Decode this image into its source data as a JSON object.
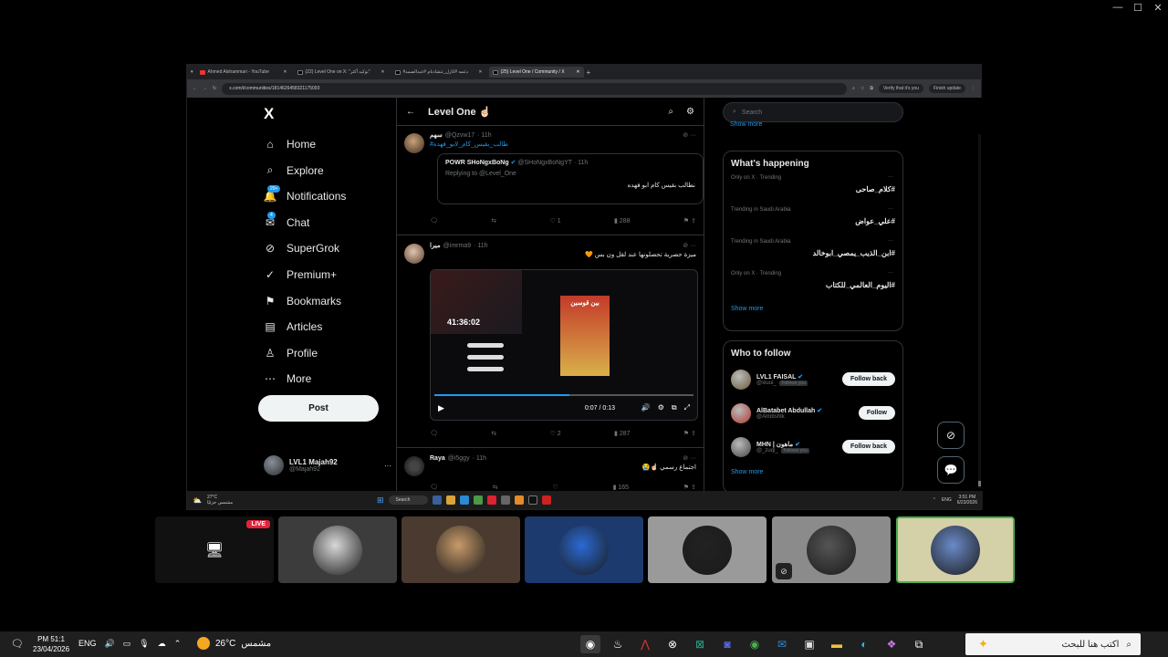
{
  "browser": {
    "tabs": [
      {
        "label": "Ahmed Alshammari - YouTube",
        "active": false
      },
      {
        "label": "(22) Level One on X: \"توكيد أكثر\"",
        "active": false
      },
      {
        "label": "#دعمه #کارل_تنشادنام #عبدالصمد",
        "active": false
      },
      {
        "label": "(25) Level One / Community / X",
        "active": true
      }
    ],
    "url": "x.com/i/communities/1814626458321175093",
    "verify_pill": "Verify that it's you",
    "finish_update": "Finish update"
  },
  "nav": {
    "logo": "X",
    "items": [
      {
        "label": "Home",
        "icon": "home-icon",
        "glyph": "⌂"
      },
      {
        "label": "Explore",
        "icon": "search-icon",
        "glyph": "⌕"
      },
      {
        "label": "Notifications",
        "icon": "bell-icon",
        "glyph": "🔔",
        "badge": "20+"
      },
      {
        "label": "Chat",
        "icon": "chat-icon",
        "glyph": "✉",
        "badge": "4"
      },
      {
        "label": "SuperGrok",
        "icon": "grok-icon",
        "glyph": "⊘"
      },
      {
        "label": "Premium+",
        "icon": "premium-icon",
        "glyph": "✓"
      },
      {
        "label": "Bookmarks",
        "icon": "bookmark-icon",
        "glyph": "⚑"
      },
      {
        "label": "Articles",
        "icon": "articles-icon",
        "glyph": "▤"
      },
      {
        "label": "Profile",
        "icon": "profile-icon",
        "glyph": "♙"
      },
      {
        "label": "More",
        "icon": "more-icon",
        "glyph": "⋯"
      }
    ],
    "post": "Post",
    "me": {
      "name": "LVL1 Majah92",
      "handle": "@Majah92"
    }
  },
  "feed": {
    "title": "Level One ☝🏻",
    "tweets": [
      {
        "name": "سهم",
        "handle": "@Qzvw17",
        "time": "· 11h",
        "text": "#طالب_بقيس_كام_لابو_فهده",
        "quote": {
          "name": "POWR SHoNgxBoNg",
          "handle": "@SHoNgxBoNgYT · 11h",
          "reply": "Replying to @Level_One",
          "text": "نطالب بقيس كام ابو فهده"
        },
        "stats": {
          "reply": "",
          "retweet": "",
          "like": "1",
          "views": "288"
        }
      },
      {
        "name": "ميرا",
        "handle": "@imrma9",
        "time": "· 11h",
        "text": "ميزة حصرية تحصلونها عند لقل ون بس 🧡",
        "video": {
          "counter": "41:36:02",
          "time": "0:07 / 0:13",
          "banner": "بين قوسين"
        },
        "stats": {
          "reply": "",
          "retweet": "",
          "like": "2",
          "views": "287"
        }
      },
      {
        "name": "Raya",
        "handle": "@i5ggy",
        "time": "· 11h",
        "text": "اجتماع رسمي ☝🏻😭",
        "stats": {
          "reply": "",
          "retweet": "",
          "like": "",
          "views": "165"
        }
      }
    ]
  },
  "right": {
    "search_placeholder": "Search",
    "show_more_top": "Show more",
    "happening_title": "What's happening",
    "trends": [
      {
        "context": "Only on X · Trending",
        "tag": "#كلام_صاحى"
      },
      {
        "context": "Trending in Saudi Arabia",
        "tag": "#علي_عواض"
      },
      {
        "context": "Trending in Saudi Arabia",
        "tag": "#ابن_الذيب_يمصي_ابوخالد"
      },
      {
        "context": "Only on X · Trending",
        "tag": "#اليوم_العالمي_للكتاب"
      }
    ],
    "show_more": "Show more",
    "follow_title": "Who to follow",
    "follow": [
      {
        "name": "LVL1 FAISAL",
        "handle": "@xiuui_",
        "follows_you": "Follows you",
        "button": "Follow back",
        "color": "#6b5a3a"
      },
      {
        "name": "AlBatabet Abdullah",
        "handle": "@Almbshtk",
        "follows_you": "",
        "button": "Follow",
        "color": "#b0392f"
      },
      {
        "name": "MHN | ماهون",
        "handle": "@_zuql_",
        "follows_you": "Follows you",
        "button": "Follow back",
        "color": "#444"
      }
    ],
    "show_more_follow": "Show more"
  },
  "inner_taskbar": {
    "weather_temp": "27°C",
    "weather_desc": "مشمس جزئيًا",
    "search": "Search",
    "lang": "ENG",
    "time": "3:51 PM",
    "date": "6/23/2026"
  },
  "participants": {
    "live": "LIVE",
    "colors": [
      "#3c3c3c",
      "#3c3c3c",
      "#4a3a30",
      "#1c3a6e",
      "#9a9a9a",
      "#8b8b8b",
      "#d4d0a8"
    ]
  },
  "taskbar": {
    "time": "PM 51:1",
    "date": "23/04/2026",
    "lang": "ENG",
    "temp": "26°C",
    "weather": "مشمس",
    "search_placeholder": "اكتب هنا للبحث"
  }
}
